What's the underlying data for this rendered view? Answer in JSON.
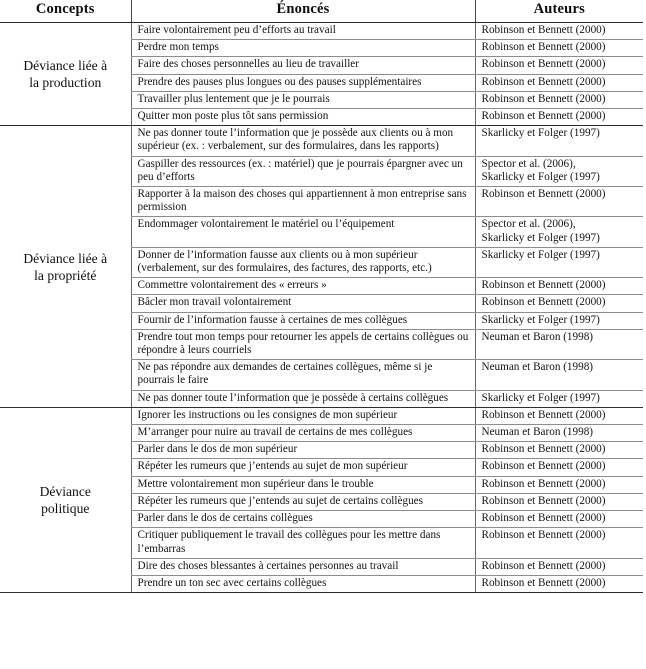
{
  "document": {
    "type": "table",
    "language": "fr",
    "title": "Tableau des concepts de déviance au travail"
  },
  "table": {
    "columns": [
      {
        "key": "concept",
        "label": "Concepts"
      },
      {
        "key": "enonce",
        "label": "Énoncés"
      },
      {
        "key": "auteur",
        "label": "Auteurs"
      }
    ],
    "groups": [
      {
        "concept": "Déviance liée à la production",
        "concept_lines": [
          "Déviance liée à",
          "la production"
        ],
        "rows": [
          {
            "enonce": "Faire volontairement peu d’efforts au travail",
            "auteurs": [
              "Robinson et Bennett (2000)"
            ]
          },
          {
            "enonce": "Perdre mon temps",
            "auteurs": [
              "Robinson et Bennett (2000)"
            ]
          },
          {
            "enonce": "Faire des choses personnelles au lieu de travailler",
            "auteurs": [
              "Robinson et Bennett (2000)"
            ]
          },
          {
            "enonce": "Prendre des pauses plus longues ou des pauses supplémentaires",
            "auteurs": [
              "Robinson et Bennett (2000)"
            ]
          },
          {
            "enonce": "Travailler plus lentement que je le pourrais",
            "auteurs": [
              "Robinson et Bennett (2000)"
            ]
          },
          {
            "enonce": "Quitter mon poste plus tôt sans permission",
            "auteurs": [
              "Robinson et Bennett (2000)"
            ]
          }
        ]
      },
      {
        "concept": "Déviance liée à la propriété",
        "concept_lines": [
          "Déviance liée à",
          "la propriété"
        ],
        "rows": [
          {
            "enonce": "Ne pas donner toute l’information que je possède aux clients ou à mon supérieur (ex. : verbalement, sur des formulaires, dans les rapports)",
            "auteurs": [
              "Skarlicky et Folger (1997)"
            ]
          },
          {
            "enonce": "Gaspiller des ressources (ex. : matériel) que je pourrais épargner avec un peu d’efforts",
            "auteurs": [
              "Spector et al. (2006),",
              "Skarlicky et Folger (1997)"
            ]
          },
          {
            "enonce": "Rapporter à la maison des choses qui appartiennent à mon entreprise sans permission",
            "auteurs": [
              "Robinson et Bennett (2000)"
            ]
          },
          {
            "enonce": "Endommager volontairement le matériel ou l’équipement",
            "auteurs": [
              "Spector et al. (2006),",
              "Skarlicky et Folger (1997)"
            ]
          },
          {
            "enonce": "Donner de l’information fausse aux clients ou à mon supérieur (verbalement, sur des formulaires, des factures, des rapports, etc.)",
            "auteurs": [
              "Skarlicky et Folger (1997)"
            ]
          },
          {
            "enonce": "Commettre volontairement des « erreurs »",
            "auteurs": [
              "Robinson et Bennett (2000)"
            ]
          },
          {
            "enonce": "Bâcler mon travail volontairement",
            "auteurs": [
              "Robinson et Bennett (2000)"
            ]
          },
          {
            "enonce": "Fournir de l’information fausse à certaines de mes collègues",
            "auteurs": [
              "Skarlicky et Folger (1997)"
            ]
          },
          {
            "enonce": "Prendre tout mon temps pour retourner les appels de certains collègues ou répondre à leurs courriels",
            "auteurs": [
              "Neuman et Baron (1998)"
            ]
          },
          {
            "enonce": "Ne pas répondre aux demandes de certaines collègues, même si je pourrais le faire",
            "auteurs": [
              "Neuman et Baron (1998)"
            ]
          },
          {
            "enonce": "Ne pas donner toute l’information que je possède à certains collègues",
            "auteurs": [
              "Skarlicky et Folger (1997)"
            ]
          }
        ]
      },
      {
        "concept": "Déviance politique",
        "concept_lines": [
          "Déviance",
          "politique"
        ],
        "rows": [
          {
            "enonce": "Ignorer les instructions ou les consignes de mon supérieur",
            "auteurs": [
              "Robinson et Bennett (2000)"
            ]
          },
          {
            "enonce": "M’arranger pour nuire au travail de certains de mes collègues",
            "auteurs": [
              "Neuman et Baron (1998)"
            ]
          },
          {
            "enonce": "Parler dans le dos de mon supérieur",
            "auteurs": [
              "Robinson et Bennett (2000)"
            ]
          },
          {
            "enonce": "Répéter les rumeurs que j’entends au sujet de mon supérieur",
            "auteurs": [
              "Robinson et Bennett (2000)"
            ]
          },
          {
            "enonce": "Mettre volontairement mon supérieur dans le trouble",
            "auteurs": [
              "Robinson et Bennett (2000)"
            ]
          },
          {
            "enonce": "Répéter les rumeurs que j’entends au sujet de certains collègues",
            "auteurs": [
              "Robinson et Bennett (2000)"
            ]
          },
          {
            "enonce": "Parler dans le dos de certains collègues",
            "auteurs": [
              "Robinson et Bennett (2000)"
            ]
          },
          {
            "enonce": "Critiquer publiquement le travail des collègues pour les mettre dans l’embarras",
            "auteurs": [
              "Robinson et Bennett (2000)"
            ]
          },
          {
            "enonce": "Dire des choses blessantes à certaines personnes au travail",
            "auteurs": [
              "Robinson et Bennett (2000)"
            ]
          },
          {
            "enonce": "Prendre un ton sec avec certains collègues",
            "auteurs": [
              "Robinson et Bennett (2000)"
            ]
          }
        ]
      }
    ]
  }
}
